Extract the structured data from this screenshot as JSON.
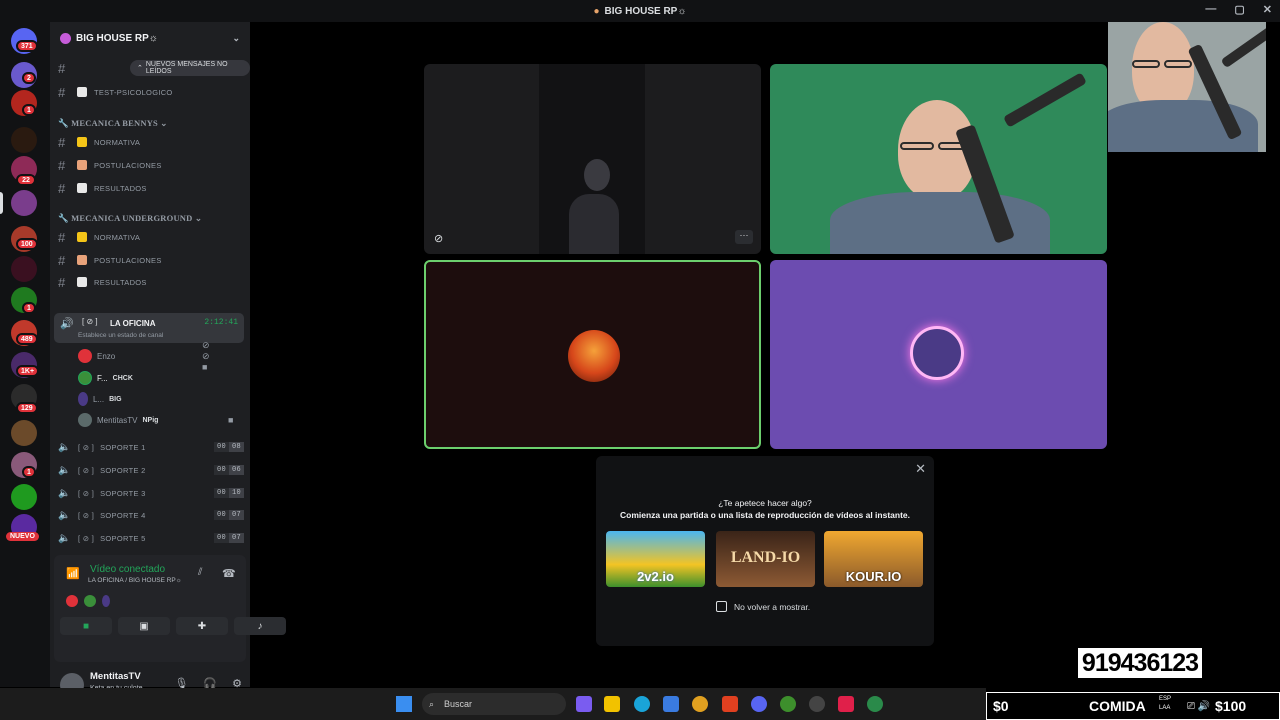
{
  "window": {
    "title": "BIG HOUSE RP☼"
  },
  "rail": {
    "badges": [
      "371",
      "2",
      "1",
      "22",
      "100",
      "1",
      "489",
      "1K+",
      "129",
      "1"
    ],
    "nuevo": "NUEVO"
  },
  "server": {
    "name": "BIG HOUSE RP☼"
  },
  "unread_pill": "NUEVOS MENSAJES NO LEÍDOS",
  "channels_top": [
    {
      "label": "TEST-PSICOLOGICO"
    }
  ],
  "categories": [
    {
      "name": "MECANICA BENNYS",
      "channels": [
        "NORMATIVA",
        "POSTULACIONES",
        "RESULTADOS"
      ]
    },
    {
      "name": "MECANICA UNDERGROUND",
      "channels": [
        "NORMATIVA",
        "POSTULACIONES",
        "RESULTADOS"
      ]
    }
  ],
  "active_voice": {
    "name": "LA OFICINA",
    "time": "2:12:41",
    "status": "Establece un estado de canal"
  },
  "members": [
    {
      "name": "Enzo",
      "tag": ""
    },
    {
      "name": "F...",
      "tag": "CHCK"
    },
    {
      "name": "L...",
      "tag": "BIG"
    },
    {
      "name": "MentitasTV",
      "tag": "NPig"
    }
  ],
  "voice_channels": [
    {
      "name": "SOPORTE 1",
      "a": "00",
      "b": "08"
    },
    {
      "name": "SOPORTE 2",
      "a": "00",
      "b": "06"
    },
    {
      "name": "SOPORTE 3",
      "a": "00",
      "b": "10"
    },
    {
      "name": "SOPORTE 4",
      "a": "00",
      "b": "07"
    },
    {
      "name": "SOPORTE 5",
      "a": "00",
      "b": "07"
    }
  ],
  "voice_panel": {
    "connected": "Vídeo conectado",
    "location": "LA OFICINA / BIG HOUSE RP☼"
  },
  "user": {
    "name": "MentitasTV",
    "status": "Keta en tu culote"
  },
  "popup": {
    "question": "¿Te apetece hacer algo?",
    "subtitle": "Comienza una partida o una lista de reproducción de vídeos al instante.",
    "games": [
      "2v2.io",
      "LAND-IO",
      "KOUR.IO"
    ],
    "checkbox": "No volver a mostrar."
  },
  "overlay": {
    "phone": "919436123",
    "money_left": "$0",
    "food": "COMIDA",
    "money_right": "$100"
  },
  "taskbar": {
    "search": "Buscar",
    "lang": "ESP",
    "lang2": "LAA"
  },
  "colors": {
    "accent": "#23a55a",
    "purple_tile": "#6c4cb0",
    "green_screen": "#2f8a5a"
  }
}
